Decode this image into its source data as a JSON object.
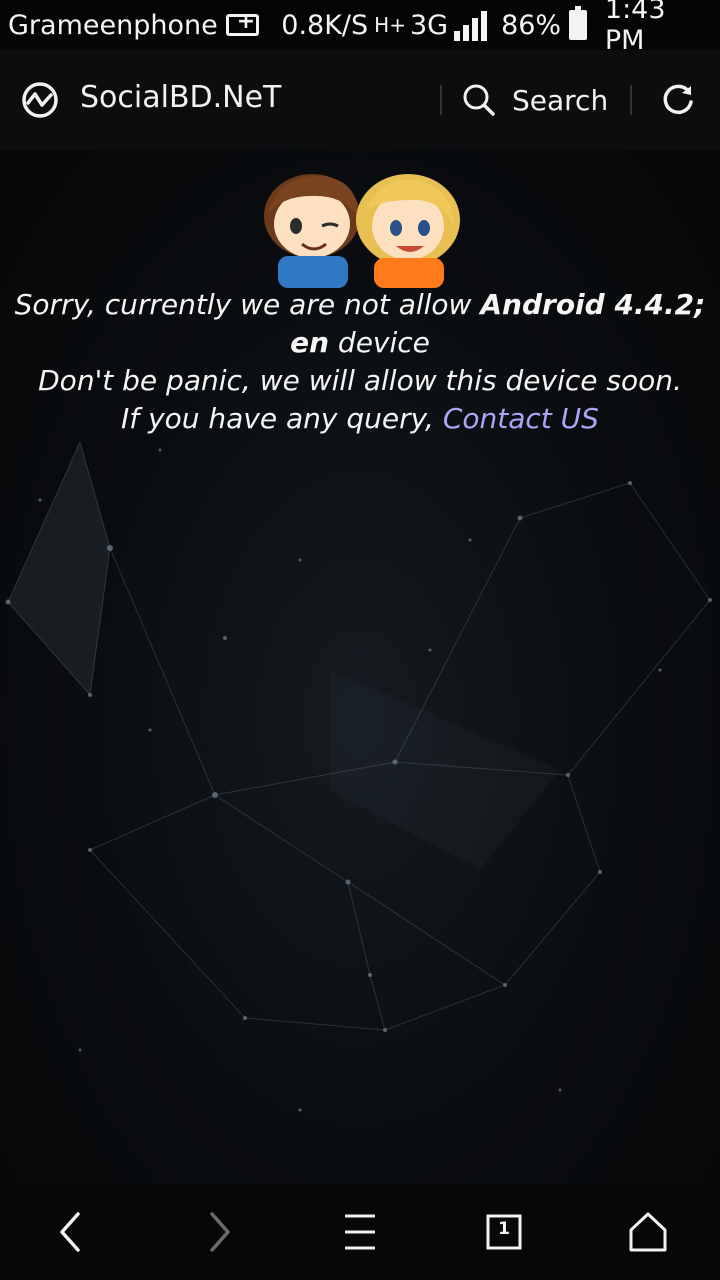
{
  "status_bar": {
    "carrier": "Grameenphone",
    "speed": "0.8K/S",
    "network_type": "H+",
    "network_gen": "3G",
    "battery_pct": "86%",
    "time": "1:43 PM",
    "icons": [
      "usb-icon",
      "data-arrows-icon",
      "signal-icon",
      "battery-icon"
    ]
  },
  "header": {
    "site_title": "SocialBD.NeT",
    "search_label": "Search",
    "icons": [
      "logo-icon",
      "search-icon",
      "refresh-icon"
    ]
  },
  "message": {
    "line1_prefix": "Sorry, currently we are not allow ",
    "device_string": "Android 4.4.2; en",
    "line1_suffix": " device",
    "line2": "Don't be panic, we will allow this device soon.",
    "line3_prefix": "If you have any query, ",
    "contact_link": "Contact US"
  },
  "bottom_nav": {
    "tab_count": "1",
    "icons": [
      "back-icon",
      "forward-icon",
      "menu-icon",
      "tabs-icon",
      "home-icon"
    ]
  },
  "colors": {
    "background": "#050607",
    "link": "#a9a6f5",
    "text": "#f5f5f5"
  }
}
